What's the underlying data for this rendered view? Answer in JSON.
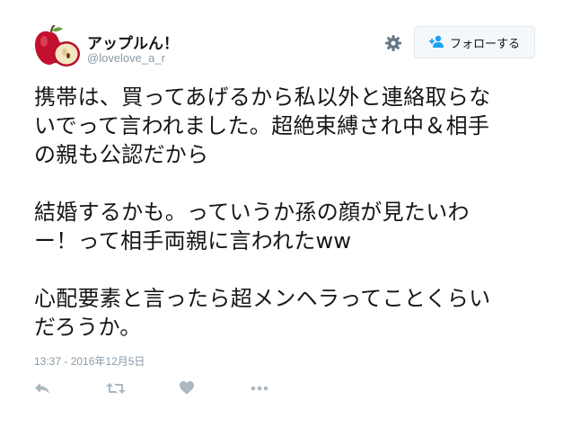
{
  "user": {
    "display_name": "アップルん！",
    "handle": "@lovelove_a_r",
    "avatar_icon": "apple-avatar-icon"
  },
  "header": {
    "settings_icon": "gear-icon",
    "follow_label": "フォローする",
    "follow_icon": "follow-user-plus-icon"
  },
  "tweet": {
    "text": "携帯は、買ってあげるから私以外と連絡取らな\nいでって言われました。超絶束縛され中＆相手\nの親も公認だから\n\n結婚するかも。っていうか孫の顔が見たいわ\nー！って相手両親に言われたww\n\n心配要素と言ったら超メンヘラってことくらい\nだろうか。",
    "timestamp": "13:37 - 2016年12月5日"
  },
  "actions": [
    {
      "name": "reply",
      "icon": "reply-icon"
    },
    {
      "name": "retweet",
      "icon": "retweet-icon"
    },
    {
      "name": "like",
      "icon": "heart-icon"
    },
    {
      "name": "more",
      "icon": "more-dots-icon"
    }
  ],
  "colors": {
    "text": "#14171a",
    "muted": "#8899a6",
    "icon": "#aab8c2",
    "button_bg": "#f5f8fa",
    "button_border": "#e1e8ed",
    "accent": "#1da1f2"
  }
}
